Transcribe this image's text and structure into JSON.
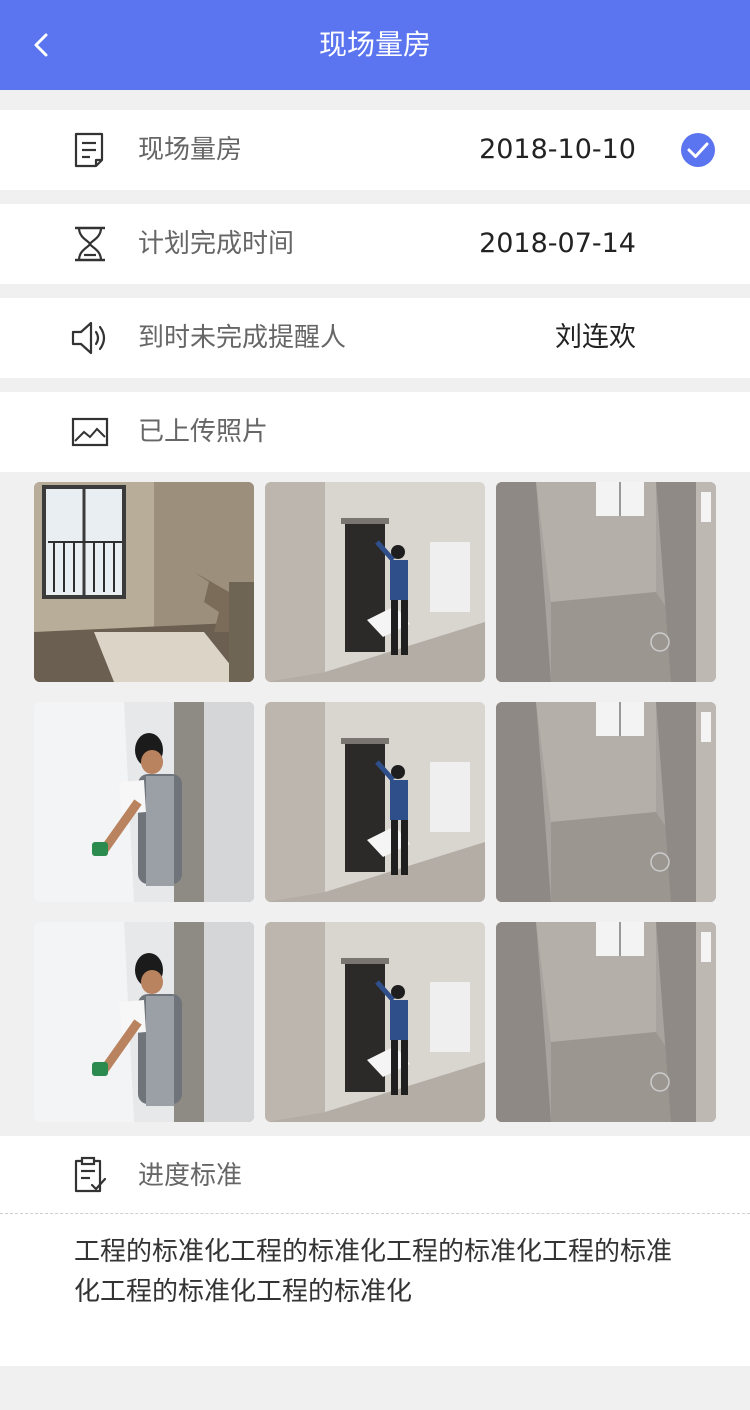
{
  "navbar": {
    "title": "现场量房"
  },
  "rows": {
    "measure": {
      "label": "现场量房",
      "value": "2018-10-10"
    },
    "plan": {
      "label": "计划完成时间",
      "value": "2018-07-14"
    },
    "reminder": {
      "label": "到时未完成提醒人",
      "value": "刘连欢"
    },
    "photos": {
      "label": "已上传照片"
    }
  },
  "photos": [
    {
      "kind": "room-window"
    },
    {
      "kind": "man-door"
    },
    {
      "kind": "corridor"
    },
    {
      "kind": "man-wall"
    },
    {
      "kind": "man-door"
    },
    {
      "kind": "corridor"
    },
    {
      "kind": "man-wall"
    },
    {
      "kind": "man-door"
    },
    {
      "kind": "corridor"
    }
  ],
  "standard": {
    "label": "进度标准",
    "text": "工程的标准化工程的标准化工程的标准化工程的标准化工程的标准化工程的标准化"
  },
  "colors": {
    "accent": "#5b74f0"
  }
}
